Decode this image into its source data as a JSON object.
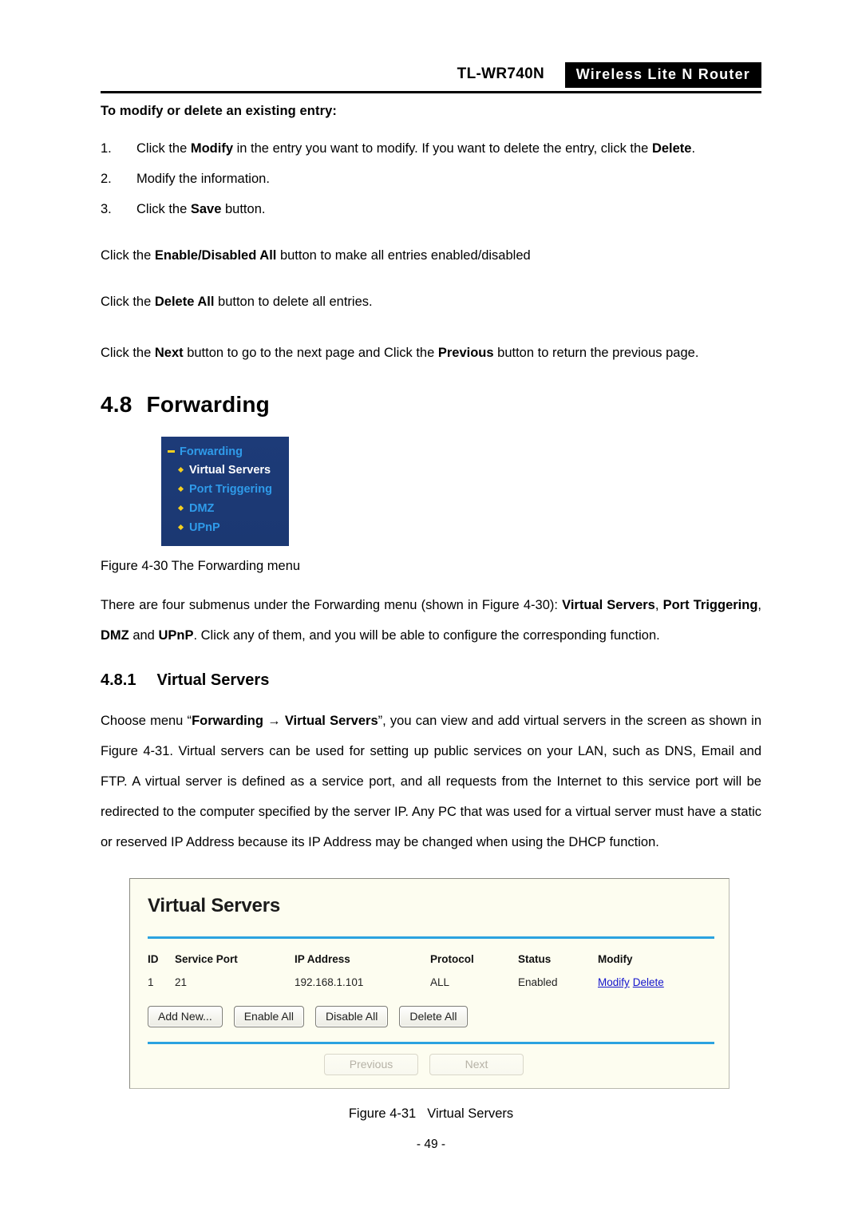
{
  "header": {
    "model": "TL-WR740N",
    "badge": "Wireless Lite N Router"
  },
  "body": {
    "lead": "To modify or delete an existing entry:",
    "steps": [
      {
        "num": "1.",
        "text_a": "Click the ",
        "bold_a": "Modify",
        "text_b": " in the entry you want to modify. If you want to delete the entry, click the ",
        "bold_b": "Delete",
        "text_c": "."
      },
      {
        "num": "2.",
        "text_a": "Modify the information.",
        "bold_a": "",
        "text_b": "",
        "bold_b": "",
        "text_c": ""
      },
      {
        "num": "3.",
        "text_a": "Click the ",
        "bold_a": "Save",
        "text_b": " button.",
        "bold_b": "",
        "text_c": ""
      }
    ],
    "note1_a": "Click the ",
    "note1_bold": "Enable/Disabled All",
    "note1_b": " button to make all entries enabled/disabled",
    "note2_a": "Click the ",
    "note2_bold": "Delete All",
    "note2_b": " button to delete all entries.",
    "note3_a": "Click the ",
    "note3_bold1": "Next",
    "note3_b": " button to go to the next page and Click the ",
    "note3_bold2": "Previous",
    "note3_c": " button to return the previous page."
  },
  "section": {
    "number": "4.8",
    "title": "Forwarding"
  },
  "subsection": {
    "number": "4.8.1",
    "title": "Virtual Servers"
  },
  "forwarding_menu": {
    "root": "Forwarding",
    "items": [
      {
        "label": "Virtual Servers",
        "active": true
      },
      {
        "label": "Port Triggering",
        "active": false
      },
      {
        "label": "DMZ",
        "active": false
      },
      {
        "label": "UPnP",
        "active": false
      }
    ],
    "caption": "Figure 4-30 The Forwarding menu"
  },
  "intro": {
    "line_a": "There are four submenus under the Forwarding menu (shown in Figure 4-30): ",
    "bold_1": "Virtual Servers",
    "line_b": ", ",
    "bold_2": "Port Triggering",
    "line_c": ", ",
    "bold_3": "DMZ",
    "line_d": " and ",
    "bold_4": "UPnP",
    "line_e": ". Click any of them, and you will be able to configure the corresponding function."
  },
  "vs_intro": {
    "a": "Choose menu “",
    "bold_1": "Forwarding",
    "arrow": " → ",
    "bold_2": "Virtual Servers",
    "b": "”, you can view and add virtual servers in the screen as shown in Figure 4-31. Virtual servers can be used for setting up public services on your LAN, such as DNS, Email and FTP. A virtual server is defined as a service port, and all requests from the Internet to this service port will be redirected to the computer specified by the server IP. Any PC that was used for a virtual server must have a static or reserved IP Address because its IP Address may be changed when using the DHCP function."
  },
  "virtual_servers_panel": {
    "title": "Virtual Servers",
    "columns": [
      "ID",
      "Service Port",
      "IP Address",
      "Protocol",
      "Status",
      "Modify"
    ],
    "rows": [
      {
        "id": "1",
        "service_port": "21",
        "ip_address": "192.168.1.101",
        "protocol": "ALL",
        "status": "Enabled",
        "modify_link": "Modify",
        "delete_link": "Delete"
      }
    ],
    "buttons": [
      {
        "label": "Add New...",
        "disabled": false
      },
      {
        "label": "Enable All",
        "disabled": false
      },
      {
        "label": "Disable All",
        "disabled": false
      },
      {
        "label": "Delete All",
        "disabled": false
      }
    ],
    "pager": [
      {
        "label": "Previous",
        "disabled": true
      },
      {
        "label": "Next",
        "disabled": true
      }
    ],
    "accent_color": "#2BA3E0",
    "background_color": "#FDFDF0",
    "link_color": "#1414CC"
  },
  "figure31_caption": {
    "number": "Figure 4-31",
    "title": "Virtual Servers"
  },
  "footer": {
    "page": "- 49 -"
  }
}
